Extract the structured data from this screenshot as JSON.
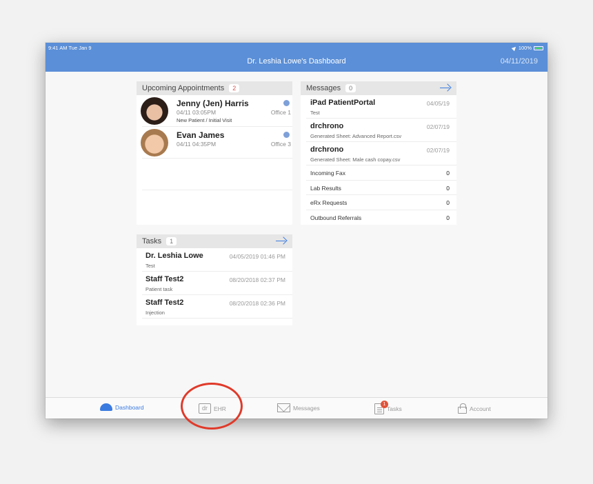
{
  "status_bar": {
    "time": "9:41 AM  Tue Jan 9",
    "battery": "100%"
  },
  "header": {
    "title": "Dr. Leshia Lowe's Dashboard",
    "date": "04/11/2019"
  },
  "appointments": {
    "title": "Upcoming Appointments",
    "count": "2",
    "items": [
      {
        "name": "Jenny (Jen) Harris",
        "time": "04/11 03:05PM",
        "type": "New Patient / Initial Visit",
        "office": "Office 1"
      },
      {
        "name": "Evan James",
        "time": "04/11 04:35PM",
        "type": "",
        "office": "Office 3"
      }
    ]
  },
  "messages": {
    "title": "Messages",
    "count": "0",
    "items": [
      {
        "name": "iPad PatientPortal",
        "sub": "Test",
        "date": "04/05/19"
      },
      {
        "name": "drchrono",
        "sub": "Generated Sheet: Advanced Report.csv",
        "date": "02/07/19"
      },
      {
        "name": "drchrono",
        "sub": "Generated Sheet: Male cash copay.csv",
        "date": "02/07/19"
      }
    ],
    "stats": [
      {
        "label": "Incoming Fax",
        "value": "0"
      },
      {
        "label": "Lab Results",
        "value": "0"
      },
      {
        "label": "eRx Requests",
        "value": "0"
      },
      {
        "label": "Outbound Referrals",
        "value": "0"
      }
    ]
  },
  "tasks": {
    "title": "Tasks",
    "count": "1",
    "items": [
      {
        "name": "Dr. Leshia Lowe",
        "sub": "Test",
        "date": "04/05/2019 01:46 PM"
      },
      {
        "name": "Staff Test2",
        "sub": "Patient task",
        "date": "08/20/2018 02:37 PM"
      },
      {
        "name": "Staff Test2",
        "sub": "Injection",
        "date": "08/20/2018 02:36 PM"
      }
    ]
  },
  "tabbar": {
    "dashboard": "Dashboard",
    "ehr": "EHR",
    "ehr_icon_text": "dr",
    "messages": "Messages",
    "tasks": "Tasks",
    "tasks_badge": "1",
    "account": "Account"
  },
  "colors": {
    "header": "#5b8fd7",
    "accent": "#3a7be0",
    "highlight_ring": "#e03a2a"
  }
}
